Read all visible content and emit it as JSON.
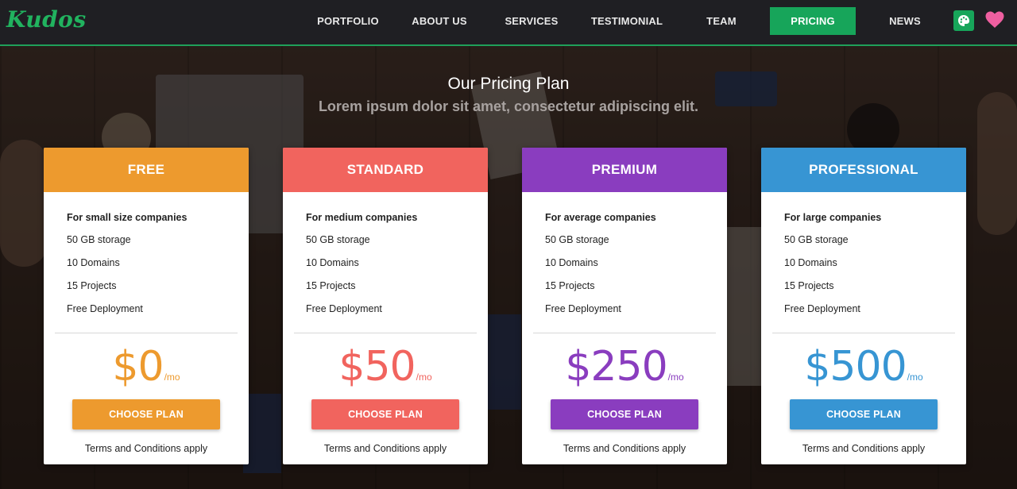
{
  "brand": {
    "logo": "Kudos",
    "accent": "#1fa05a"
  },
  "nav": {
    "items": [
      {
        "label": "PORTFOLIO"
      },
      {
        "label": "ABOUT US"
      },
      {
        "label": "SERVICES"
      },
      {
        "label": "TESTIMONIAL"
      },
      {
        "label": "TEAM"
      },
      {
        "label": "PRICING",
        "active": true
      },
      {
        "label": "NEWS"
      }
    ],
    "icons": [
      "palette-icon",
      "heart-icon"
    ]
  },
  "section": {
    "title": "Our Pricing Plan",
    "subtitle": "Lorem ipsum dolor sit amet, consectetur adipiscing elit."
  },
  "plans": [
    {
      "name": "FREE",
      "color": "#ed9a2e",
      "audience": "For small size companies",
      "features": [
        "50 GB storage",
        "10 Domains",
        "15 Projects",
        "Free Deployment"
      ],
      "price": "$0",
      "period": "/mo",
      "cta": "CHOOSE PLAN",
      "terms": "Terms and Conditions apply"
    },
    {
      "name": "STANDARD",
      "color": "#f1645e",
      "audience": "For medium companies",
      "features": [
        "50 GB storage",
        "10 Domains",
        "15 Projects",
        "Free Deployment"
      ],
      "price": "$50",
      "period": "/mo",
      "cta": "CHOOSE PLAN",
      "terms": "Terms and Conditions apply"
    },
    {
      "name": "PREMIUM",
      "color": "#8a3dbf",
      "audience": "For average companies",
      "features": [
        "50 GB storage",
        "10 Domains",
        "15 Projects",
        "Free Deployment"
      ],
      "price": "$250",
      "period": "/mo",
      "cta": "CHOOSE PLAN",
      "terms": "Terms and Conditions apply"
    },
    {
      "name": "PROFESSIONAL",
      "color": "#3795d3",
      "audience": "For large companies",
      "features": [
        "50 GB storage",
        "10 Domains",
        "15 Projects",
        "Free Deployment"
      ],
      "price": "$500",
      "period": "/mo",
      "cta": "CHOOSE PLAN",
      "terms": "Terms and Conditions apply"
    }
  ]
}
